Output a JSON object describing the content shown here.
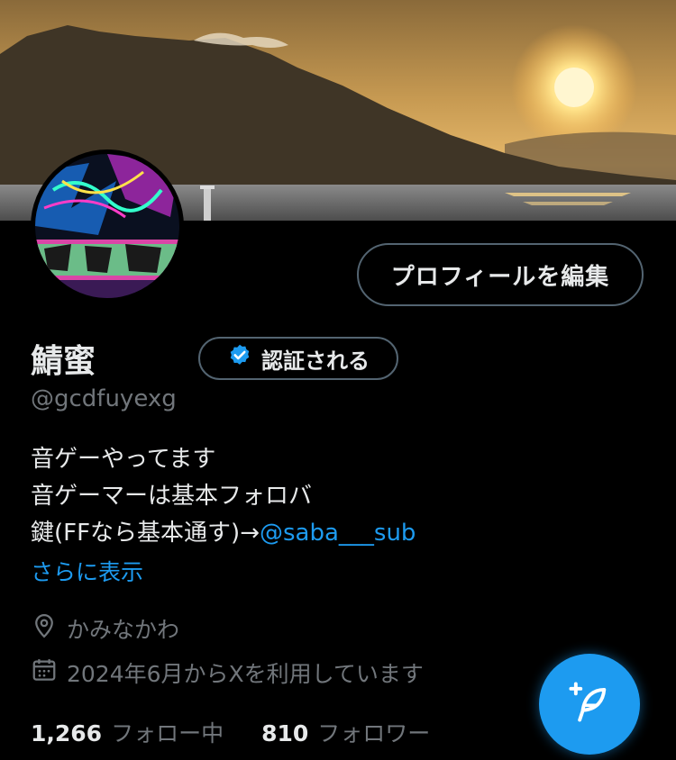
{
  "profile": {
    "display_name": "鯖蜜",
    "handle": "@gcdfuyexg",
    "verify_label": "認証される",
    "edit_profile_label": "プロフィールを編集",
    "bio": {
      "line1": "音ゲーやってます",
      "line2": "音ゲーマーは基本フォロバ",
      "line3_prefix": "鍵(FFなら基本通す)→",
      "line3_mention": "@saba___sub"
    },
    "show_more_label": "さらに表示",
    "location": "かみなかわ",
    "joined": "2024年6月からXを利用しています",
    "stats": {
      "following_count": "1,266",
      "following_label": "フォロー中",
      "followers_count": "810",
      "followers_label": "フォロワー"
    }
  },
  "icons": {
    "verify": "verified-badge-icon",
    "location": "location-pin-icon",
    "calendar": "calendar-icon",
    "compose": "compose-feather-icon"
  },
  "colors": {
    "background": "#000000",
    "accent": "#1d9bf0",
    "text_primary": "#e7e9ea",
    "text_secondary": "#71767b",
    "border": "#536471"
  }
}
